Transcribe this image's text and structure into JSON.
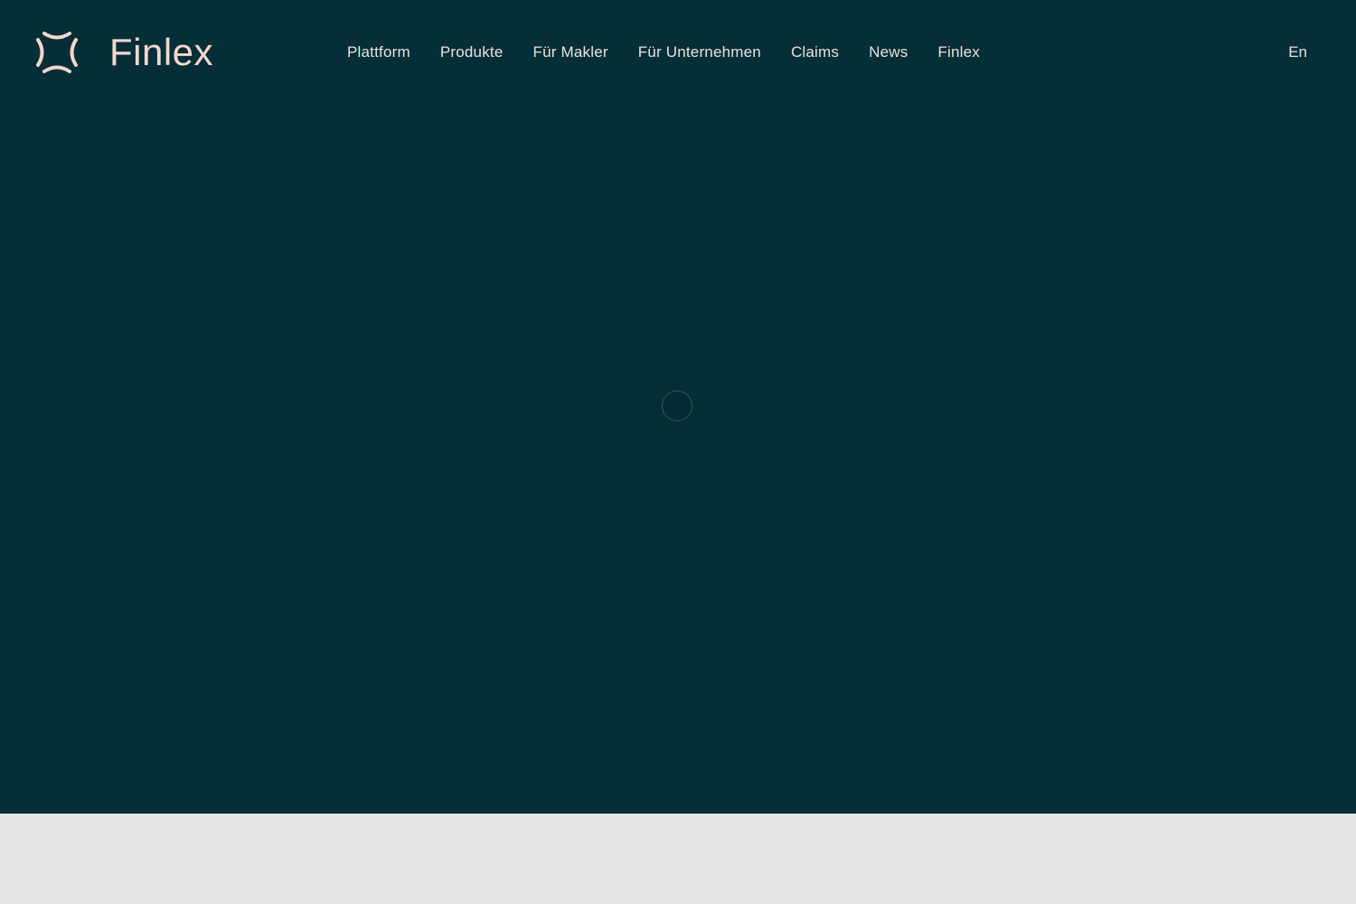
{
  "brand": {
    "name": "Finlex",
    "logo_icon": "finlex-mark-icon",
    "accent_color": "#f4d7cd",
    "background_color": "#042f38"
  },
  "nav": {
    "items": [
      {
        "label": "Plattform"
      },
      {
        "label": "Produkte"
      },
      {
        "label": "Für Makler"
      },
      {
        "label": "Für Unternehmen"
      },
      {
        "label": "Claims"
      },
      {
        "label": "News"
      },
      {
        "label": "Finlex"
      }
    ]
  },
  "language_switch": {
    "label": "En"
  },
  "loader": {
    "icon": "loading-spinner-icon"
  }
}
